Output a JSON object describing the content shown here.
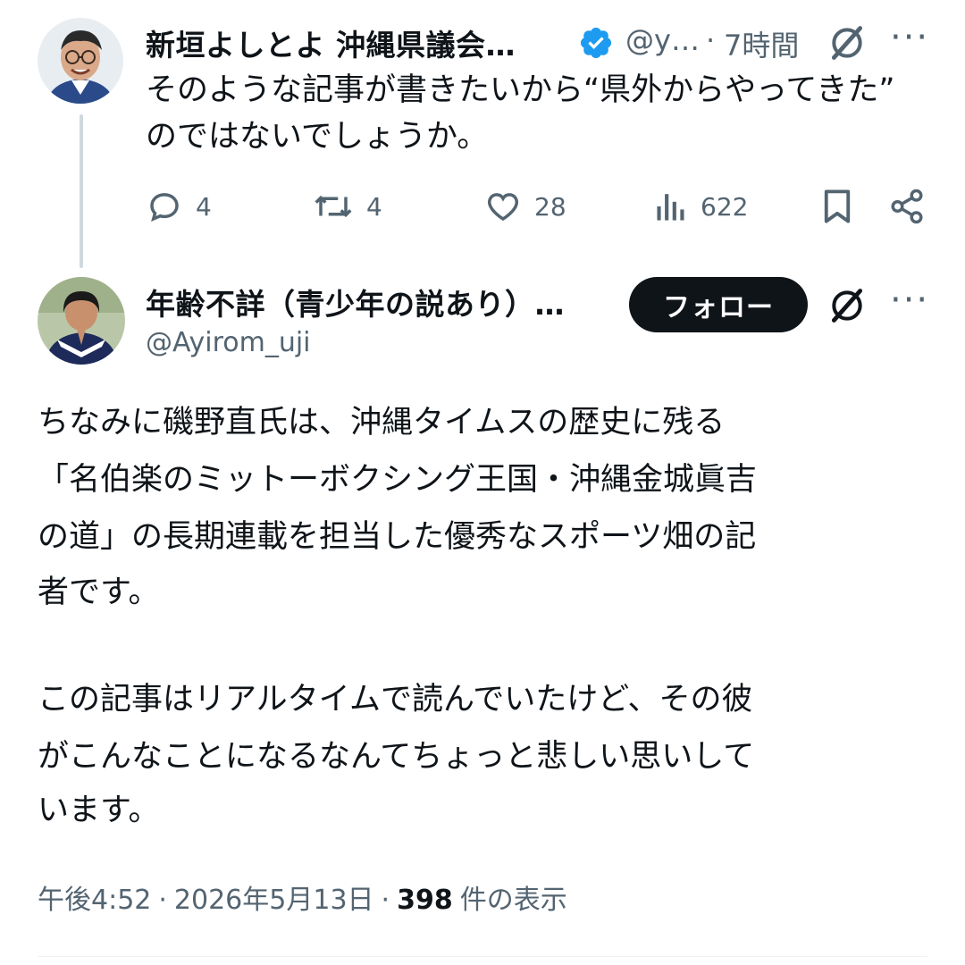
{
  "reply_parent": {
    "display_name": "新垣よしとよ 沖縄県議会…",
    "handle": "@y…",
    "separator": "·",
    "time": "7時間",
    "text_line1": "そのような記事が書きたいから“県外からやってきた”",
    "text_line2": "のではないでしょうか。",
    "stats": {
      "replies": "4",
      "reposts": "4",
      "likes": "28",
      "views": "622"
    },
    "verified_color": "#1d9bf0"
  },
  "main_tweet": {
    "display_name": "年齢不詳（青少年の説あり）…",
    "handle": "@Ayirom_uji",
    "follow_label": "フォロー",
    "paragraph1": [
      "ちなみに磯野直氏は、沖縄タイムスの歴史に残る",
      "「名伯楽のミットーボクシング王国・沖縄金城眞吉",
      "の道」の長期連載を担当した優秀なスポーツ畑の記",
      "者です。"
    ],
    "paragraph2": [
      "この記事はリアルタイムで読んでいたけど、その彼",
      "がこんなことになるなんてちょっと悲しい思いして",
      "います。"
    ],
    "meta": {
      "time": "午後4:52",
      "sep1": "·",
      "date": "2026年5月13日",
      "sep2": "·",
      "views_count": "398",
      "views_label": "件の表示"
    }
  },
  "icons": {
    "reply": "reply-icon",
    "repost": "repost-icon",
    "like": "heart-icon",
    "views": "views-icon",
    "bookmark": "bookmark-icon",
    "share": "share-icon",
    "grok": "grok-icon",
    "more": "more-icon",
    "verified": "verified-badge-icon"
  },
  "colors": {
    "text": "#0f1419",
    "muted": "#536471",
    "thread_line": "#cfd9de",
    "follow_bg": "#0f1419"
  }
}
